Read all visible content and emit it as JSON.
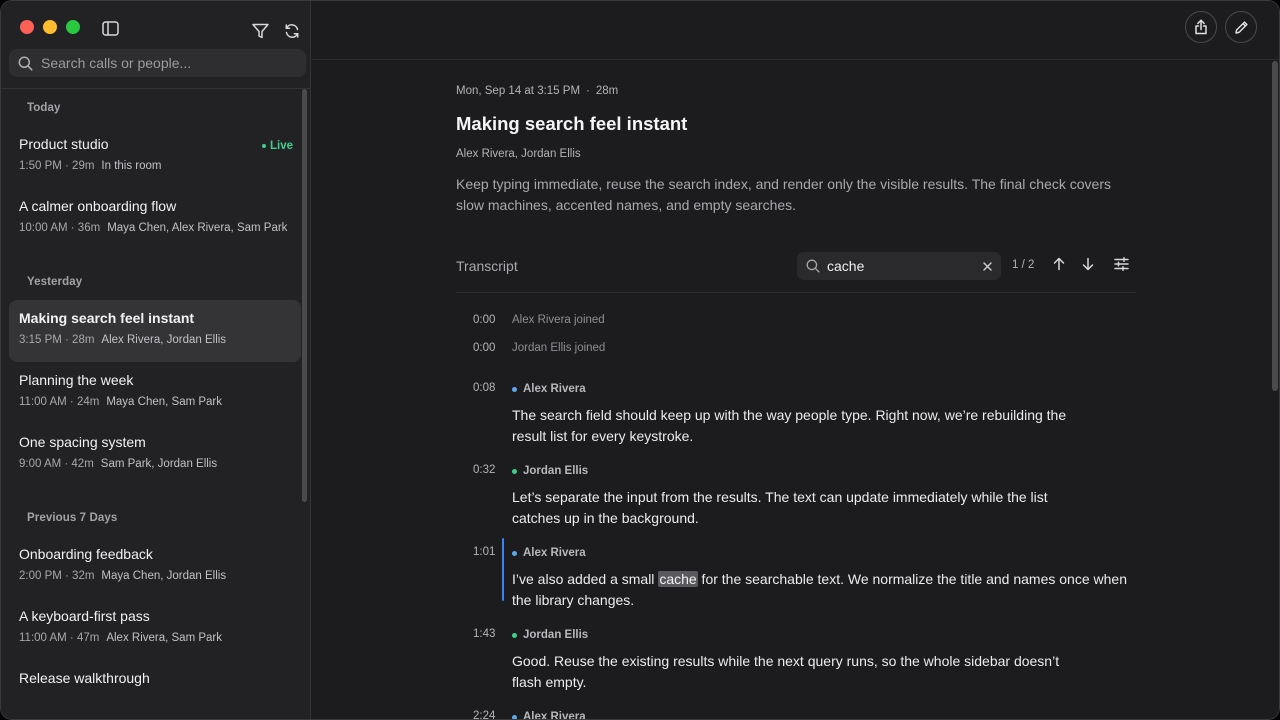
{
  "sidebar": {
    "search_placeholder": "Search calls or people...",
    "groups": [
      {
        "label": "Today",
        "items": [
          {
            "title": "Product studio",
            "time": "1:50 PM · 29m",
            "people": "In this room",
            "badge": "Live"
          },
          {
            "title": "A calmer onboarding flow",
            "time": "10:00 AM · 36m",
            "people": "Maya Chen, Alex Rivera, Sam Park"
          }
        ]
      },
      {
        "label": "Yesterday",
        "items": [
          {
            "title": "Making search feel instant",
            "time": "3:15 PM · 28m",
            "people": "Alex Rivera, Jordan Ellis",
            "selected": true
          },
          {
            "title": "Planning the week",
            "time": "11:00 AM · 24m",
            "people": "Maya Chen, Sam Park"
          },
          {
            "title": "One spacing system",
            "time": "9:00 AM · 42m",
            "people": "Sam Park, Jordan Ellis"
          }
        ]
      },
      {
        "label": "Previous 7 Days",
        "items": [
          {
            "title": "Onboarding feedback",
            "time": "2:00 PM · 32m",
            "people": "Maya Chen, Jordan Ellis"
          },
          {
            "title": "A keyboard-first pass",
            "time": "11:00 AM · 47m",
            "people": "Alex Rivera, Sam Park"
          },
          {
            "title": "Release walkthrough",
            "time": "",
            "people": ""
          }
        ]
      }
    ]
  },
  "call": {
    "datetime": "Mon, Sep 14 at 3:15 PM",
    "duration": "28m",
    "title": "Making search feel instant",
    "participants": "Alex Rivera, Jordan Ellis",
    "summary": "Keep typing immediate, reuse the search index, and render only the visible results. The final check covers slow machines, accented names, and empty searches."
  },
  "transcript": {
    "label": "Transcript",
    "find_query": "cache",
    "match_count": "1 / 2",
    "events": [
      {
        "time": "0:00",
        "text": "Alex Rivera joined"
      },
      {
        "time": "0:00",
        "text": "Jordan Ellis joined"
      }
    ],
    "turns": [
      {
        "time": "0:08",
        "speaker": "Alex Rivera",
        "before": "The search field should keep up with the way people type. Right now, we’re rebuilding the result list for every keystroke.",
        "match": "",
        "after": ""
      },
      {
        "time": "0:32",
        "speaker": "Jordan Ellis",
        "before": "Let’s separate the input from the results. The text can update immediately while the list catches up in the background.",
        "match": "",
        "after": ""
      },
      {
        "time": "1:01",
        "speaker": "Alex Rivera",
        "before": "I’ve also added a small ",
        "match": "cache",
        "after": " for the searchable text. We normalize the title and names once when the library changes.",
        "active": true
      },
      {
        "time": "1:43",
        "speaker": "Jordan Ellis",
        "before": "Good. Reuse the existing results while the next query runs, so the whole sidebar doesn’t flash empty.",
        "match": "",
        "after": ""
      },
      {
        "time": "2:24",
        "speaker": "Alex Rivera",
        "before": "",
        "match": "",
        "after": ""
      }
    ]
  },
  "colors": {
    "live": "#3ecf8e",
    "speaker_alex": "#5aa9f0",
    "speaker_jordan": "#3ecf8e",
    "active_marker": "#3b82f6"
  },
  "icons": {
    "sidebar_toggle": "sidebar-toggle-icon",
    "filter": "filter-icon",
    "refresh": "refresh-icon",
    "search": "search-icon",
    "share": "share-icon",
    "edit": "pencil-icon",
    "clear": "close-icon",
    "prev": "arrow-up-icon",
    "next": "arrow-down-icon",
    "options": "sliders-icon"
  }
}
